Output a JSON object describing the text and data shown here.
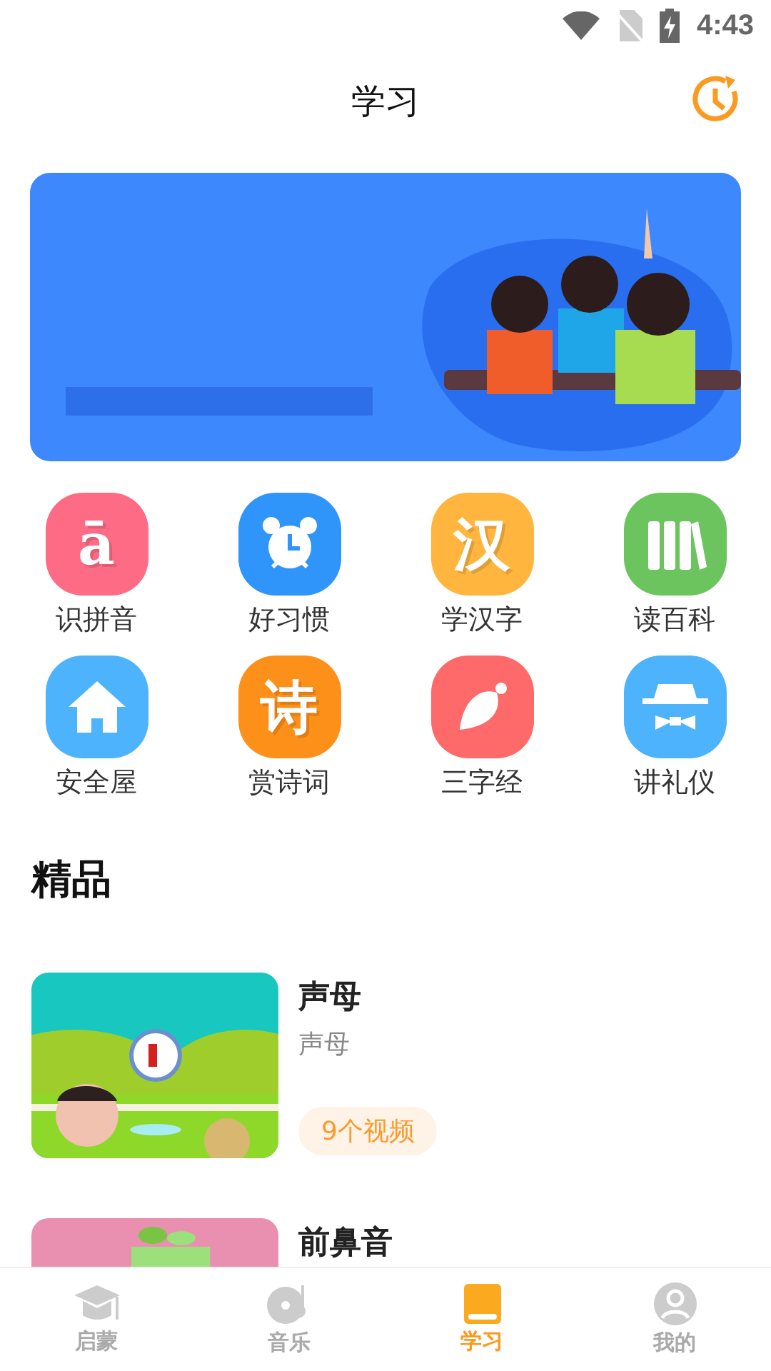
{
  "status_bar": {
    "time": "4:43"
  },
  "header": {
    "title": "学习"
  },
  "categories": [
    {
      "label": "识拼音",
      "color": "#fd6b85",
      "kind": "glyph",
      "glyph": "ā"
    },
    {
      "label": "好习惯",
      "color": "#2f95fb",
      "kind": "clock"
    },
    {
      "label": "学汉字",
      "color": "#ffb53e",
      "kind": "glyph",
      "glyph": "汉"
    },
    {
      "label": "读百科",
      "color": "#6cc45e",
      "kind": "books"
    },
    {
      "label": "安全屋",
      "color": "#4db3fc",
      "kind": "house"
    },
    {
      "label": "赏诗词",
      "color": "#fd9019",
      "kind": "glyph",
      "glyph": "诗"
    },
    {
      "label": "三字经",
      "color": "#fe6a6a",
      "kind": "leaf"
    },
    {
      "label": "讲礼仪",
      "color": "#4db3fc",
      "kind": "hat"
    }
  ],
  "section": {
    "title": "精品"
  },
  "courses": [
    {
      "title": "声母",
      "subtitle": "声母",
      "count": "9个视频",
      "kind": "teal"
    },
    {
      "title": "前鼻音",
      "kind": "pink"
    }
  ],
  "tab_bar": [
    {
      "label": "启蒙",
      "kind": "cap",
      "selected": false
    },
    {
      "label": "音乐",
      "kind": "disc",
      "selected": false
    },
    {
      "label": "学习",
      "kind": "book",
      "selected": true
    },
    {
      "label": "我的",
      "kind": "person",
      "selected": false
    }
  ]
}
